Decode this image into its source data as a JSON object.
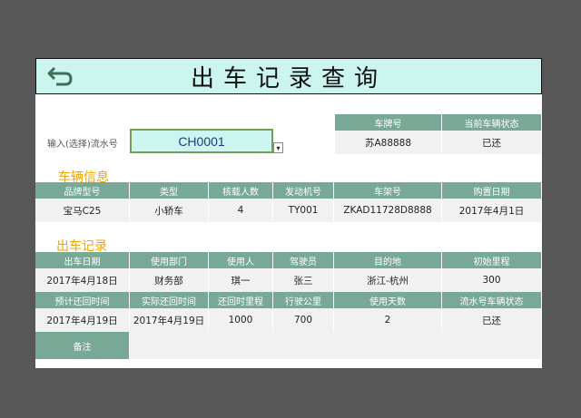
{
  "title": "出车记录查询",
  "input": {
    "label": "输入(选择)流水号",
    "value": "CH0001",
    "dropdown_arrow": "▾"
  },
  "status_box": {
    "headers": [
      "车牌号",
      "当前车辆状态"
    ],
    "values": [
      "苏A88888",
      "已还"
    ]
  },
  "vehicle_info": {
    "title": "车辆信息",
    "headers": [
      "品牌型号",
      "类型",
      "核载人数",
      "发动机号",
      "车架号",
      "购置日期"
    ],
    "values": [
      "宝马C25",
      "小轿车",
      "4",
      "TY001",
      "ZKAD11728D8888",
      "2017年4月1日"
    ]
  },
  "trip_record": {
    "title": "出车记录",
    "headers1": [
      "出车日期",
      "使用部门",
      "使用人",
      "驾驶员",
      "目的地",
      "初始里程"
    ],
    "values1": [
      "2017年4月18日",
      "财务部",
      "琪一",
      "张三",
      "浙江-杭州",
      "300"
    ],
    "headers2": [
      "预计还回时间",
      "实际还回时间",
      "还回时里程",
      "行驶公里",
      "使用天数",
      "流水号车辆状态"
    ],
    "values2": [
      "2017年4月19日",
      "2017年4月19日",
      "1000",
      "700",
      "2",
      "已还"
    ],
    "remark_label": "备注",
    "remark_value": ""
  },
  "icons": {
    "back": "back-arrow-icon"
  },
  "colors": {
    "header": "#78a896",
    "title_bg": "#ccf5f0",
    "section_title": "#f0a500",
    "background": "#575757"
  }
}
